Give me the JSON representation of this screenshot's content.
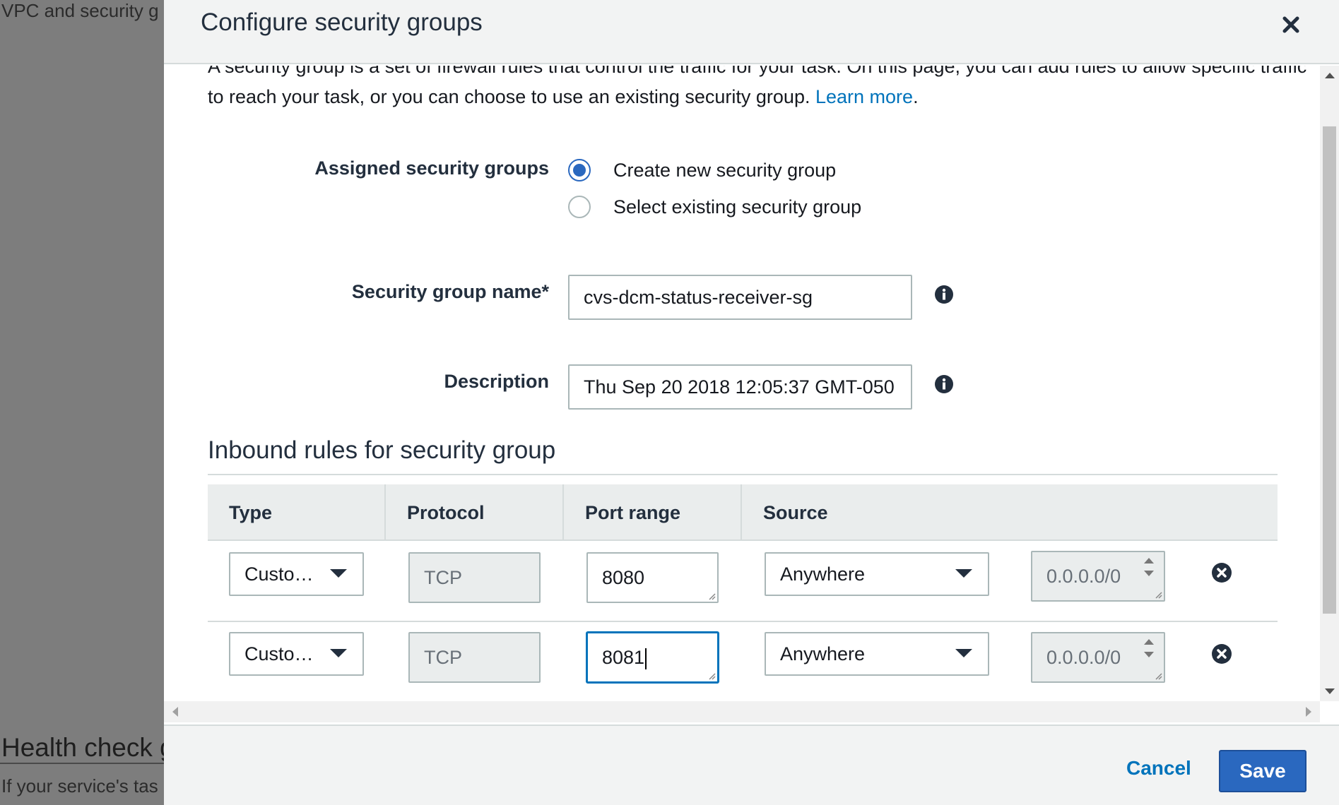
{
  "background": {
    "top_text": "VPC and security g",
    "heading": "Health check g",
    "body_text": "If your service's tas"
  },
  "modal": {
    "title": "Configure security groups",
    "intro_text": "A security group is a set of firewall rules that control the traffic for your task. On this page, you can add rules to allow specific traffic to reach your task, or you can choose to use an existing security group.",
    "learn_more": "Learn more",
    "intro_end": ".",
    "assigned_label": "Assigned security groups",
    "radio_options": [
      {
        "label": "Create new security group",
        "checked": true
      },
      {
        "label": "Select existing security group",
        "checked": false
      }
    ],
    "name_label": "Security group name*",
    "name_value": "cvs-dcm-status-receiver-sg",
    "description_label": "Description",
    "description_value": "Thu Sep 20 2018 12:05:37 GMT-050",
    "inbound_title": "Inbound rules for security group",
    "table": {
      "headers": [
        "Type",
        "Protocol",
        "Port range",
        "Source"
      ],
      "rows": [
        {
          "type": "Custo…",
          "protocol": "TCP",
          "port": "8080",
          "source": "Anywhere",
          "cidr": "0.0.0.0/0"
        },
        {
          "type": "Custo…",
          "protocol": "TCP",
          "port": "8081",
          "source": "Anywhere",
          "cidr": "0.0.0.0/0"
        }
      ]
    },
    "cancel_label": "Cancel",
    "save_label": "Save"
  },
  "colors": {
    "accent": "#2a68bf",
    "link": "#0073bb",
    "header_bg": "#f2f3f3"
  }
}
